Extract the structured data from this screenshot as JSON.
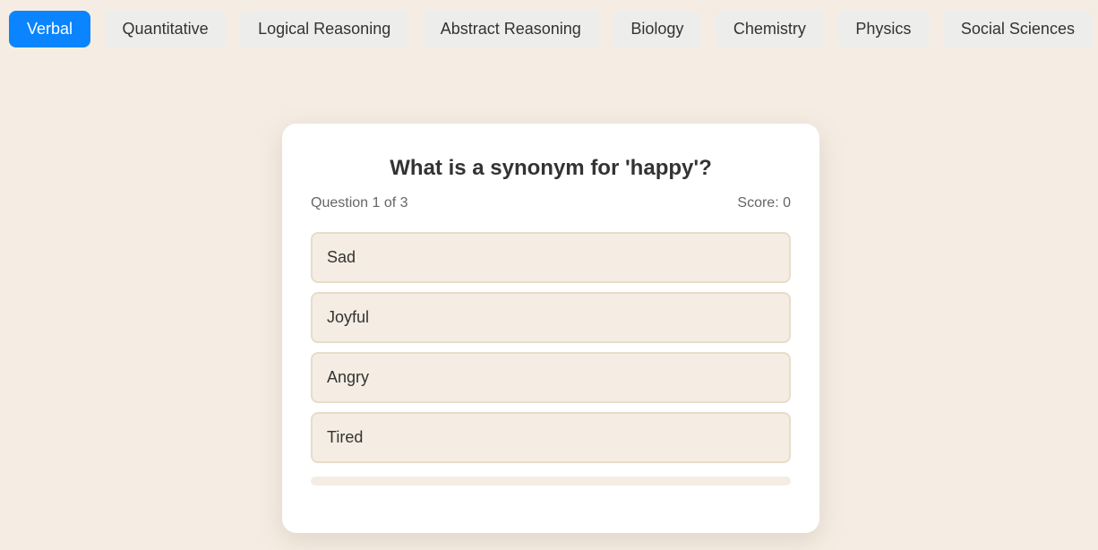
{
  "tabs": [
    {
      "label": "Verbal",
      "active": true
    },
    {
      "label": "Quantitative",
      "active": false
    },
    {
      "label": "Logical Reasoning",
      "active": false
    },
    {
      "label": "Abstract Reasoning",
      "active": false
    },
    {
      "label": "Biology",
      "active": false
    },
    {
      "label": "Chemistry",
      "active": false
    },
    {
      "label": "Physics",
      "active": false
    },
    {
      "label": "Social Sciences",
      "active": false
    }
  ],
  "quiz": {
    "question": "What is a synonym for 'happy'?",
    "progress_text": "Question 1 of 3",
    "score_text": "Score: 0",
    "options": [
      "Sad",
      "Joyful",
      "Angry",
      "Tired"
    ],
    "progress_fraction": 0
  },
  "colors": {
    "accent": "#0a84ff",
    "background": "#f5ede3",
    "option_border": "#e8dccb"
  }
}
